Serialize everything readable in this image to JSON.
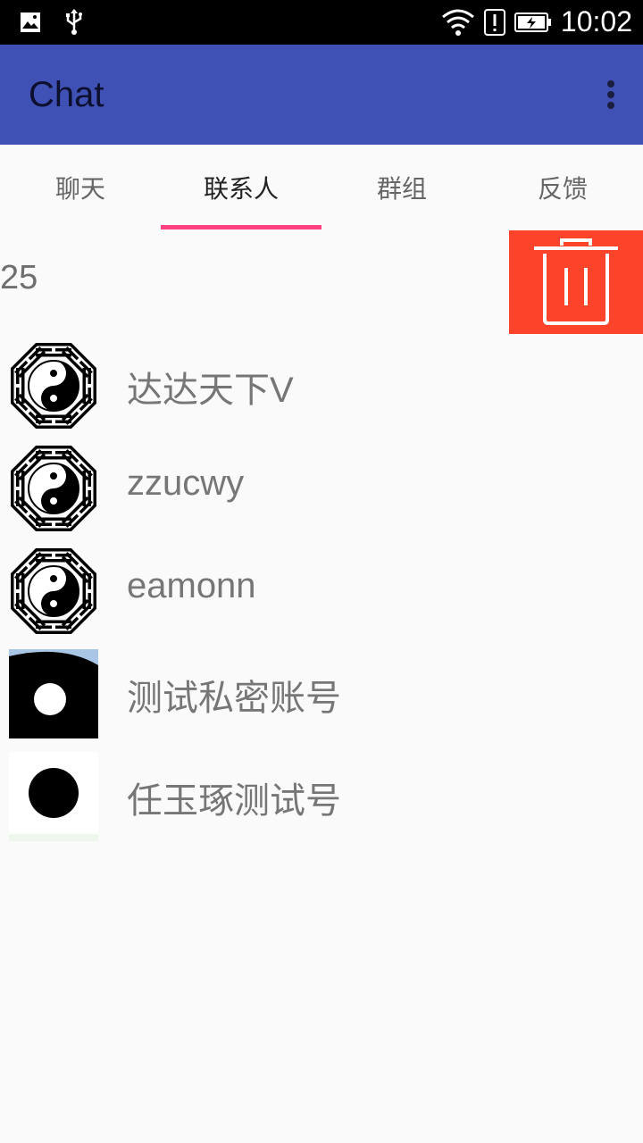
{
  "status_bar": {
    "time": "10:02",
    "icons": [
      "image-notification-icon",
      "usb-icon",
      "wifi-icon",
      "alert-icon",
      "battery-charging-icon"
    ]
  },
  "app_bar": {
    "title": "Chat",
    "overflow_icon": "more-vert-icon",
    "color": "#3f51b5"
  },
  "tabs": [
    {
      "label": "聊天",
      "active": false
    },
    {
      "label": "联系人",
      "active": true
    },
    {
      "label": "群组",
      "active": false
    },
    {
      "label": "反馈",
      "active": false
    }
  ],
  "accent": "#ff4081",
  "swipe_action": {
    "icon": "trash-icon",
    "color": "#fb4429"
  },
  "contact_group": {
    "label": "25"
  },
  "contacts": [
    {
      "name": "达达天下V",
      "avatar": "bagua-yinyang-avatar"
    },
    {
      "name": "zzucwy",
      "avatar": "bagua-yinyang-avatar"
    },
    {
      "name": "eamonn",
      "avatar": "bagua-yinyang-avatar"
    },
    {
      "name": "测试私密账号",
      "avatar": "photo-avatar"
    },
    {
      "name": "任玉琢测试号",
      "avatar": "photo-avatar"
    }
  ]
}
